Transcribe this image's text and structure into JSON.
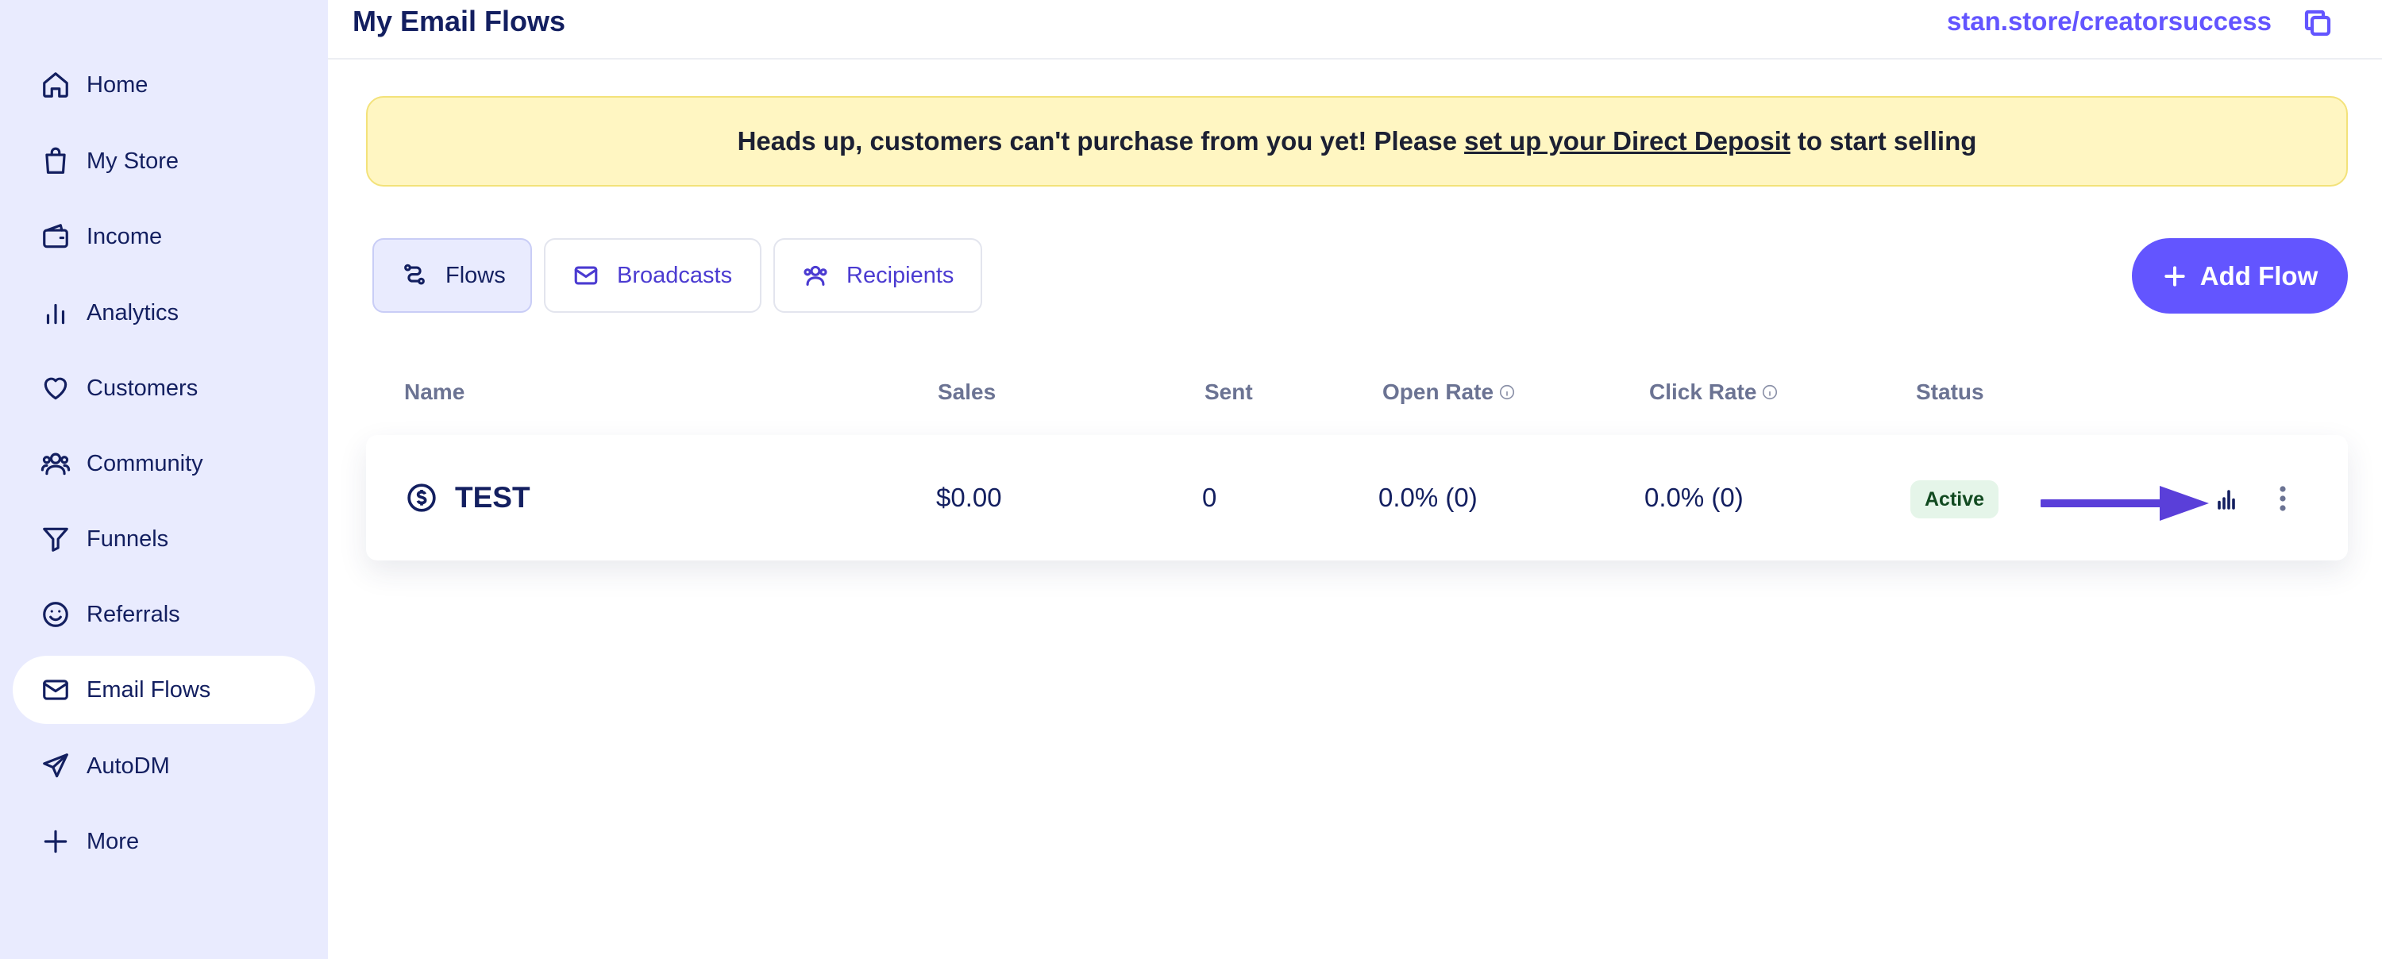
{
  "sidebar": {
    "items": [
      {
        "label": "Home",
        "icon": "home-icon"
      },
      {
        "label": "My Store",
        "icon": "shopping-bag-icon"
      },
      {
        "label": "Income",
        "icon": "wallet-icon"
      },
      {
        "label": "Analytics",
        "icon": "bar-chart-icon"
      },
      {
        "label": "Customers",
        "icon": "heart-icon"
      },
      {
        "label": "Community",
        "icon": "users-icon"
      },
      {
        "label": "Funnels",
        "icon": "filter-icon"
      },
      {
        "label": "Referrals",
        "icon": "smile-icon"
      },
      {
        "label": "Email Flows",
        "icon": "mail-icon",
        "active": true
      },
      {
        "label": "AutoDM",
        "icon": "send-icon"
      },
      {
        "label": "More",
        "icon": "plus-icon"
      }
    ]
  },
  "header": {
    "title": "My Email Flows",
    "store_link": "stan.store/creatorsuccess",
    "copy_icon": "copy-icon"
  },
  "alert": {
    "text_before": "Heads up, customers can't purchase from you yet! Please",
    "link_text": "set up your Direct Deposit",
    "text_after": "to start selling"
  },
  "tabs": [
    {
      "label": "Flows",
      "icon": "flows-icon",
      "active": true
    },
    {
      "label": "Broadcasts",
      "icon": "mail-icon"
    },
    {
      "label": "Recipients",
      "icon": "users-icon"
    }
  ],
  "add_flow": {
    "label": "Add Flow",
    "icon": "plus-icon"
  },
  "table": {
    "columns": [
      "Name",
      "Sales",
      "Sent",
      "Open Rate",
      "Click Rate",
      "Status"
    ],
    "rows": [
      {
        "name": "TEST",
        "icon": "dollar-circle-icon",
        "sales": "$0.00",
        "sent": "0",
        "open_rate": "0.0% (0)",
        "click_rate": "0.0% (0)",
        "status": "Active"
      }
    ]
  },
  "colors": {
    "accent": "#6355ff",
    "sidebar_bg": "#e9ebfe",
    "text_dark": "#131f60",
    "alert_bg": "#fff6c2",
    "status_active_bg": "#e5f5e9",
    "annotation_arrow": "#5a3fd9"
  }
}
